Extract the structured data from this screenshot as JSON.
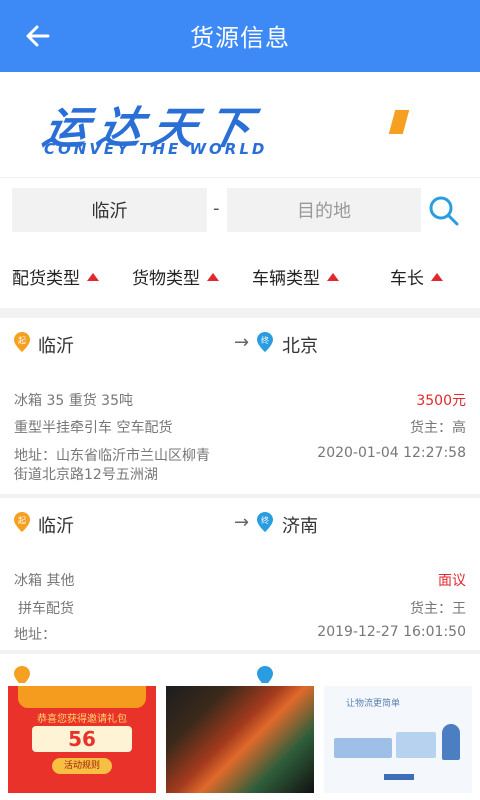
{
  "header": {
    "title": "货源信息"
  },
  "banner": {
    "logo_cn": "运达天下",
    "logo_en": "CONVEY THE WORLD"
  },
  "search": {
    "origin": "临沂",
    "separator": "-",
    "destination_placeholder": "目的地"
  },
  "filters": [
    {
      "label": "配货类型"
    },
    {
      "label": "货物类型"
    },
    {
      "label": "车辆类型"
    },
    {
      "label": "车长"
    }
  ],
  "cargo_list": [
    {
      "start_badge": "起",
      "end_badge": "终",
      "origin": "临沂",
      "destination": "北京",
      "arrow": "→",
      "goods": "冰箱 35 重货 35吨",
      "price": "3500元",
      "vehicle": "重型半挂牵引车 空车配货",
      "owner": "货主：高",
      "address_line1": "地址：山东省临沂市兰山区柳青",
      "address_line2": "街道北京路12号五洲湖",
      "time": "2020-01-04 12:27:58"
    },
    {
      "start_badge": "起",
      "end_badge": "终",
      "origin": "临沂",
      "destination": "济南",
      "arrow": "→",
      "goods": "冰箱  其他",
      "price": "面议",
      "vehicle": "拼车配货",
      "owner": "货主：王",
      "address_line1": "地址：",
      "time": "2019-12-27 16:01:50"
    }
  ],
  "ads": {
    "ad1_title": "恭喜您获得邀请礼包",
    "ad1_amount": "56",
    "ad1_button": "活动规则",
    "ad3_title": "让物流更简单"
  },
  "colors": {
    "primary": "#3d8af7",
    "price_red": "#e0282e",
    "badge_orange": "#f5a021",
    "badge_blue": "#2a9de0"
  }
}
